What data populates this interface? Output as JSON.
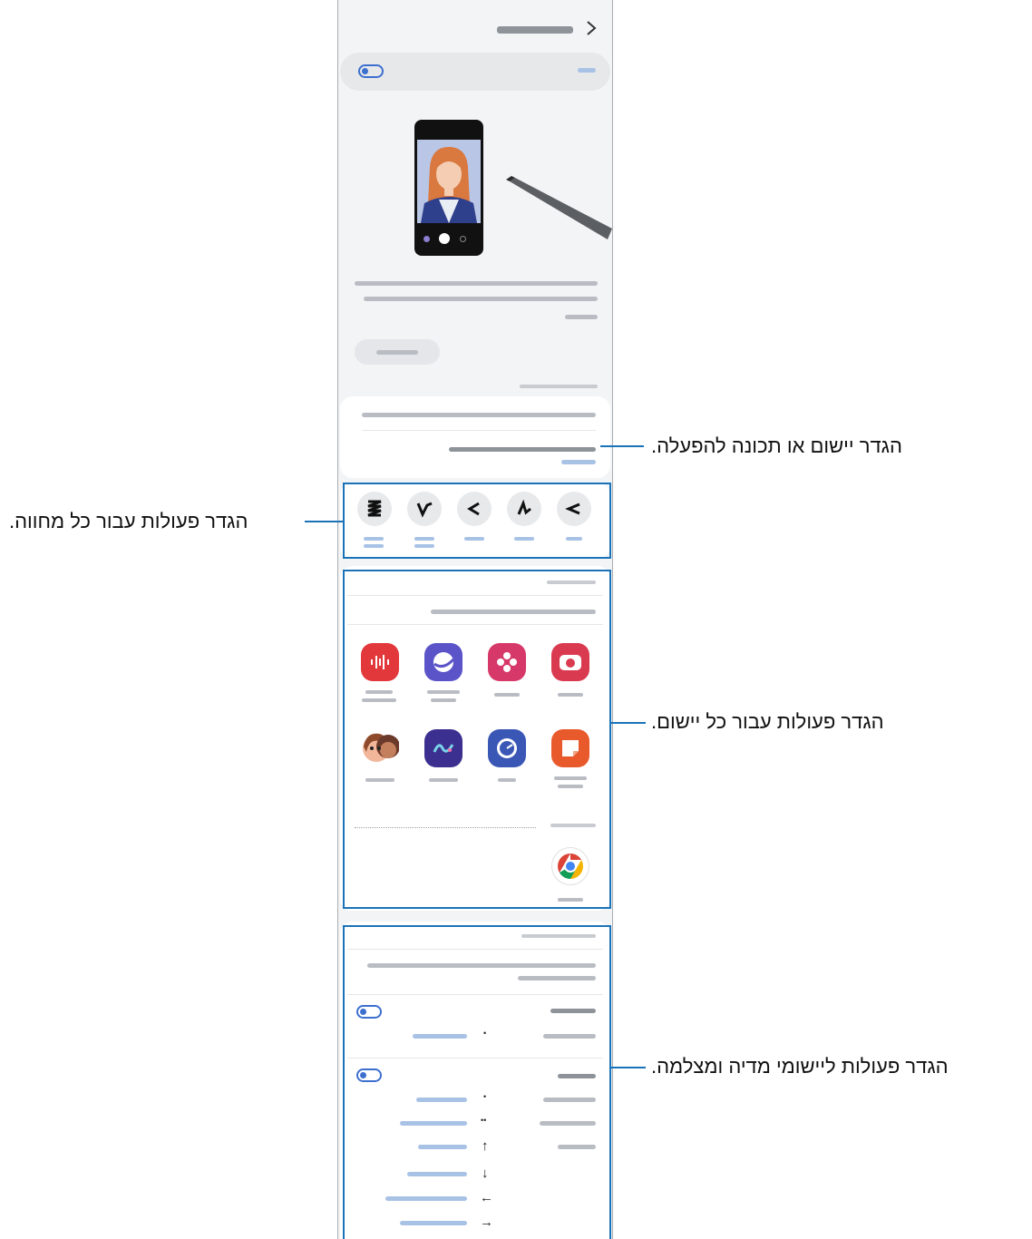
{
  "callouts": [
    "הגדר יישום או תכונה להפעלה.",
    "הגדר פעולות עבור כל מחווה.",
    "הגדר פעולות עבור כל יישום.",
    "הגדר פעולות ליישומי מדיה ומצלמה."
  ],
  "header": {
    "back_icon": "chevron-right-icon"
  },
  "gestures": [
    "lightning",
    "flick-up",
    "swipe",
    "zigzag",
    "shake"
  ],
  "apps": [
    "camera",
    "gallery",
    "internet",
    "voice-recorder",
    "notes",
    "clock",
    "pen-up",
    "ar-emoji",
    "chrome"
  ],
  "arrows": {
    "dot1": "•",
    "dot2": "•",
    "dots": "••",
    "up": "↑",
    "down": "↓",
    "left": "←",
    "right": "→"
  },
  "colors": {
    "accent": "#1a73b8",
    "toggle": "#3d6fcf"
  }
}
